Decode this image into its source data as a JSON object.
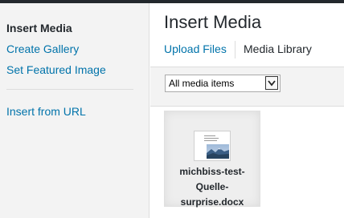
{
  "menu": {
    "items": [
      {
        "label": "Insert Media"
      },
      {
        "label": "Create Gallery"
      },
      {
        "label": "Set Featured Image"
      },
      {
        "label": "Insert from URL"
      }
    ]
  },
  "panel": {
    "title": "Insert Media",
    "tabs": [
      {
        "label": "Upload Files"
      },
      {
        "label": "Media Library"
      }
    ]
  },
  "filter": {
    "selected": "All media items"
  },
  "attachments": [
    {
      "filename": "michbiss-test-\nQuelle-\nsurprise.docx",
      "icon": "document-icon"
    }
  ]
}
